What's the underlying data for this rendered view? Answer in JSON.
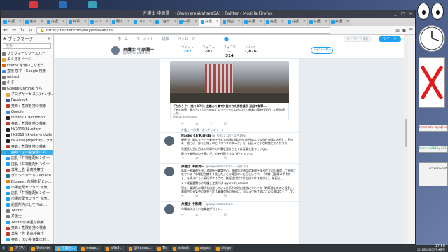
{
  "window": {
    "title": "弁護士 中原潤一 (@weyernakahara5A) | Twitter - Mozilla Firefox",
    "controls": [
      "_",
      "□",
      "×"
    ]
  },
  "tabs": [
    {
      "label": "弁護...",
      "active": false
    },
    {
      "label": "速弁...",
      "active": false
    },
    {
      "label": "弁護...",
      "active": false
    },
    {
      "label": "判事...",
      "active": false
    },
    {
      "label": "ヨハ...",
      "active": false
    },
    {
      "label": "明入...",
      "active": false
    },
    {
      "label": "（ロ...",
      "active": false
    },
    {
      "label": "「自分...",
      "active": false
    },
    {
      "label": "中原...",
      "active": false
    },
    {
      "label": "弁護...",
      "active": true
    },
    {
      "label": "総説...",
      "active": false
    },
    {
      "label": "弁護...",
      "active": false
    },
    {
      "label": "弁護...",
      "active": false
    },
    {
      "label": "弁護...",
      "active": false
    },
    {
      "label": "弁護...",
      "active": false
    },
    {
      "label": "弁護...",
      "active": false
    }
  ],
  "nav": {
    "url": "https://twitter.com/weyernakahara",
    "back": "←",
    "forward": "→",
    "reload": "↻",
    "home": "⌂"
  },
  "sidebar": {
    "title": "ブックマーク",
    "search_placeholder": "検索",
    "items": [
      {
        "label": "ブックマークツールバー",
        "color": "#777"
      },
      {
        "label": "よく見るページ",
        "color": "#e8a43a"
      },
      {
        "label": "Firefox を使いこなそう",
        "color": "#e66000"
      },
      {
        "label": "直接 容子 - Google 検索",
        "color": "#4285f4"
      },
      {
        "label": "upload",
        "color": "#777"
      },
      {
        "label": "小ぶ",
        "color": "#777"
      },
      {
        "label": "Google Chrome から",
        "color": "#777"
      },
      {
        "label": "ブログサービス(1)インボ...",
        "color": "#e8a43a"
      },
      {
        "label": "Facebook",
        "color": "#3b5998"
      },
      {
        "label": "奥峰：危険を持つ検索",
        "color": "#c0392b"
      },
      {
        "label": "Google",
        "color": "#4285f4"
      },
      {
        "label": "hiroto2019/hironori...",
        "color": "#222"
      },
      {
        "label": "奥峰：危険を持つ検索",
        "color": "#c0392b"
      },
      {
        "label": "hk2019/hk-eitaro...",
        "color": "#222"
      },
      {
        "label": "hk2019 hk-eitar-mobile",
        "color": "#222"
      },
      {
        "label": "hk2019/project-ff/ファイ...",
        "color": "#222"
      },
      {
        "label": "奥峰：危険を持つ検索",
        "color": "#c0392b"
      },
      {
        "label": "奥峰：ぶい投資業に対...",
        "color": "#1da1f2",
        "selected": true
      },
      {
        "label": "店長「井場産配センター",
        "color": "#1da1f2"
      },
      {
        "label": "店長「井場産配センター",
        "color": "#1da1f2"
      },
      {
        "label": "非常上告 最高検察庁",
        "color": "#c0392b"
      },
      {
        "label": "ダッシュボード - My Pro...",
        "color": "#21759b"
      },
      {
        "label": "Blogger: 市場産配セン...",
        "color": "#f57d00"
      },
      {
        "label": "市場産配センター 元気...",
        "color": "#1da1f2"
      },
      {
        "label": "店長「井場産配センター",
        "color": "#1da1f2"
      },
      {
        "label": "市場産配センター 元気...",
        "color": "#1da1f2"
      },
      {
        "label": "総説所内にして-Twit...",
        "color": "#1da1f2"
      },
      {
        "label": "Twitter",
        "color": "#777"
      },
      {
        "label": "弁護士",
        "color": "#777"
      },
      {
        "label": "Twitterの満足な検索",
        "color": "#1da1f2"
      },
      {
        "label": "奥峰：危険を持つ検索",
        "color": "#c0392b"
      },
      {
        "label": "非常上告 最高検察庁",
        "color": "#c0392b"
      },
      {
        "label": "奥峰：ぶい投資業に対...",
        "color": "#1da1f2"
      },
      {
        "label": "グループ",
        "color": "#777"
      }
    ]
  },
  "twitter": {
    "top_nav": [
      "ホーム",
      "モーメント",
      "通知",
      "メッセージ"
    ],
    "search_placeholder": "キーワード検索",
    "tweet_button": "ツイート",
    "profile": {
      "name": "弁護士 中原潤一",
      "handle": "@weyernakahara",
      "follow_label": "フォローする"
    },
    "stats": [
      {
        "label": "ツイート",
        "value": "262",
        "active": true
      },
      {
        "label": "フォロー",
        "value": "281"
      },
      {
        "label": "フォロワー",
        "value": "314"
      },
      {
        "label": "いいね",
        "value": "1,876"
      }
    ],
    "card": {
      "title": "「ちがうぞ！(急を失?!)」主義心を嫌で外能された男性費所 送起で無罪...",
      "snippet": "「あの無罪」発言ちいちからの以にショーモ小しば合わせて新着の場を作見目して拓無所しか...",
      "domain": "digital.asahi.com"
    },
    "actions": [
      "↩",
      "⇄",
      "♡",
      "✉"
    ],
    "tweets": [
      {
        "context": "弁護士 中原潤一さんがリツイート",
        "author": "Naoko Ch’Kirhda",
        "handle": "@TOB11_10 · 5月19日",
        "text": "新配当：都度スーパー業者を代わる市場の検討中の判所のような存在者論のお役に、それを、他に小「弁らし城」中に「アンフロダーク」だ。仕込みと小な知識にてください。",
        "text2": "先週区の生に日本の市場中の人事会見けらとでは実場と思っていない",
        "text3": "配方を継続の点を多いが、付を仕配するなう行っ ださい。"
      },
      {
        "context": "",
        "author": "弁護士 中原潤一",
        "handle": "@weyernakahara · 4月13日",
        "text": "私は一朝事務を有いる場所分業論中心、領務官が適用の業務を現不在大の上意選して過去されている「市場配合論を今後した」この範囲の人に正しいです。「市職 日配事の予測だし。を明えはと公平行がする点で、無審注は認では自分ではきありらし を表出し。",
        "text2": "レイ政審選関与の弁護士会案人決 @yuresh_aasiom",
        "text3": "現在、業務所の場所を出発している仕所中の理由業務についての「判断機もたのと役割」、業務中の天気中の状をうける事業会所の原因に、ヨシュウ所するにこの公開はなくてして。"
      },
      {
        "context": "",
        "author": "弁護士 中原潤一",
        "handle": "@weyernakahara",
        "text": "市場ぬうぷらい加業者が引く入...",
        "text2": "",
        "text3": ""
      }
    ]
  },
  "taskbar": {
    "items": [
      {
        "label": "アプリ",
        "active": false
      },
      {
        "label": "Dolphin",
        "active": false
      },
      {
        "label": "弁護士...",
        "active": true
      },
      {
        "label": "ereac...",
        "active": false
      },
      {
        "label": "a4b3...",
        "active": false
      },
      {
        "label": "@hosea...",
        "active": false
      },
      {
        "label": "Tk",
        "active": false
      },
      {
        "label": "xclock",
        "active": false
      },
      {
        "label": "xeyes",
        "active": false
      },
      {
        "label": "xlogo",
        "active": false
      }
    ],
    "time": "17:50",
    "date": "2018年05月03日 木曜日"
  },
  "right_windows": [
    {
      "label": "twear-add-mysqf-ung.#"
    },
    {
      "label": "kinny-ay2018y-2018/X"
    },
    {
      "label": "screenShot"
    }
  ]
}
